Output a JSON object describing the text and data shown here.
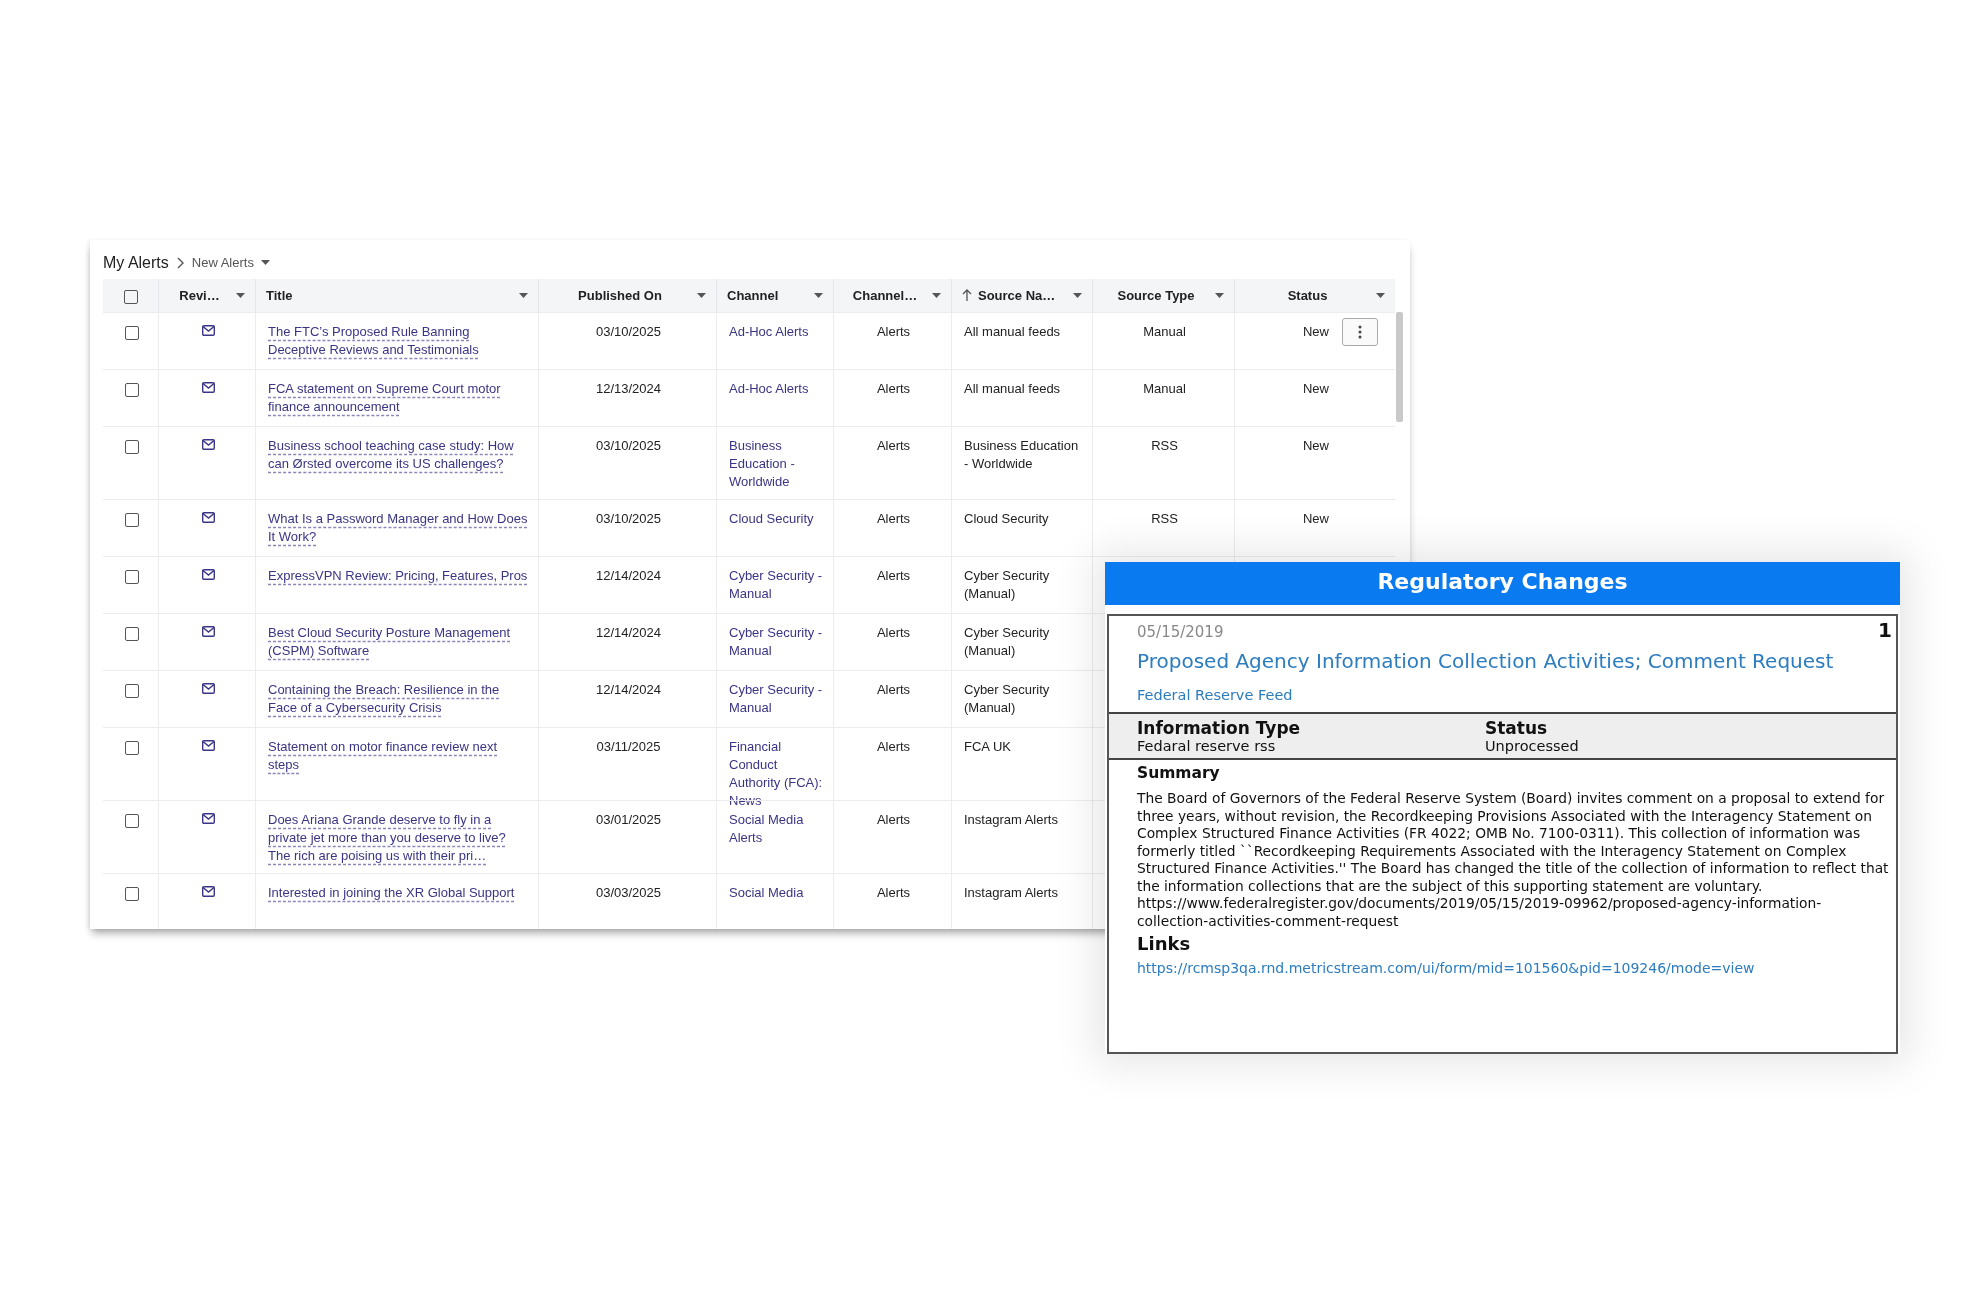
{
  "breadcrumb": {
    "root": "My Alerts",
    "current": "New Alerts"
  },
  "table": {
    "select_all_checked": false,
    "columns": [
      {
        "label": "Revi…",
        "sorted": false
      },
      {
        "label": "Title",
        "sorted": false
      },
      {
        "label": "Published On",
        "sorted": false
      },
      {
        "label": "Channel",
        "sorted": false
      },
      {
        "label": "Channel…",
        "sorted": false
      },
      {
        "label": "Source Na…",
        "sorted": true
      },
      {
        "label": "Source Type",
        "sorted": false
      },
      {
        "label": "Status",
        "sorted": false
      }
    ],
    "rows": [
      {
        "checked": false,
        "show_actions": true,
        "cells": [
          "",
          "The FTC’s Proposed Rule Banning Deceptive Reviews and Testimonials",
          "03/10/2025",
          "Ad-Hoc Alerts",
          "Alerts",
          "All manual feeds",
          "Manual",
          "New"
        ]
      },
      {
        "checked": false,
        "show_actions": false,
        "cells": [
          "",
          "FCA statement on Supreme Court motor finance announcement",
          "12/13/2024",
          "Ad-Hoc Alerts",
          "Alerts",
          "All manual feeds",
          "Manual",
          "New"
        ]
      },
      {
        "checked": false,
        "show_actions": false,
        "cells": [
          "",
          "Business school teaching case study: How can Ørsted overcome its US challenges?",
          "03/10/2025",
          "Business Education - Worldwide",
          "Alerts",
          "Business Education - Worldwide",
          "RSS",
          "New"
        ]
      },
      {
        "checked": false,
        "show_actions": false,
        "cells": [
          "",
          "What Is a Password Manager and How Does It Work?",
          "03/10/2025",
          "Cloud Security",
          "Alerts",
          "Cloud Security",
          "RSS",
          "New"
        ]
      },
      {
        "checked": false,
        "show_actions": false,
        "cells": [
          "",
          "ExpressVPN Review: Pricing, Features, Pros",
          "12/14/2024",
          "Cyber Security - Manual",
          "Alerts",
          "Cyber Security (Manual)"
        ]
      },
      {
        "checked": false,
        "show_actions": false,
        "cells": [
          "",
          "Best Cloud Security Posture Management (CSPM) Software",
          "12/14/2024",
          "Cyber Security - Manual",
          "Alerts",
          "Cyber Security (Manual)"
        ]
      },
      {
        "checked": false,
        "show_actions": false,
        "cells": [
          "",
          "Containing the Breach: Resilience in the Face of a Cybersecurity Crisis",
          "12/14/2024",
          "Cyber Security - Manual",
          "Alerts",
          "Cyber Security (Manual)"
        ]
      },
      {
        "checked": false,
        "show_actions": false,
        "cells": [
          "",
          "Statement on motor finance review next steps",
          "03/11/2025",
          "Financial Conduct Authority (FCA): News",
          "Alerts",
          "FCA UK"
        ]
      },
      {
        "checked": false,
        "show_actions": false,
        "cells": [
          "",
          "Does Ariana Grande deserve to fly in a private jet more than you deserve to live? The rich are poising us with their pri…",
          "03/01/2025",
          "Social Media Alerts",
          "Alerts",
          "Instagram Alerts"
        ]
      },
      {
        "checked": false,
        "show_actions": false,
        "cells": [
          "",
          "Interested in joining the XR Global Support",
          "03/03/2025",
          "Social Media",
          "Alerts",
          "Instagram Alerts"
        ]
      }
    ]
  },
  "detail": {
    "header": "Regulatory Changes",
    "date": "05/15/2019",
    "index": "1",
    "title": "Proposed Agency Information Collection Activities; Comment Request",
    "feed": "Federal Reserve Feed",
    "fields": [
      {
        "label": "Information Type",
        "value": "Fedaral reserve rss"
      },
      {
        "label": "Status",
        "value": "Unprocessed"
      }
    ],
    "summary_label": "Summary",
    "summary": "The Board of Governors of the Federal Reserve System (Board) invites comment on a proposal to extend for three years, without revision, the Recordkeeping Provisions Associated with the Interagency Statement on Complex Structured Finance Activities (FR 4022; OMB No. 7100-0311). This collection of information was formerly titled ``Recordkeeping Requirements Associated with the Interagency Statement on Complex Structured Finance Activities.'' The Board has changed the title of the collection of information to reflect that the information collections that are the subject of this supporting statement are voluntary. https://www.federalregister.gov/documents/2019/05/15/2019-09962/proposed-agency-information-collection-activities-comment-request",
    "links_label": "Links",
    "links": [
      "https://rcmsp3qa.rnd.metricstream.com/ui/form/mid=101560&pid=109246/mode=view"
    ]
  }
}
